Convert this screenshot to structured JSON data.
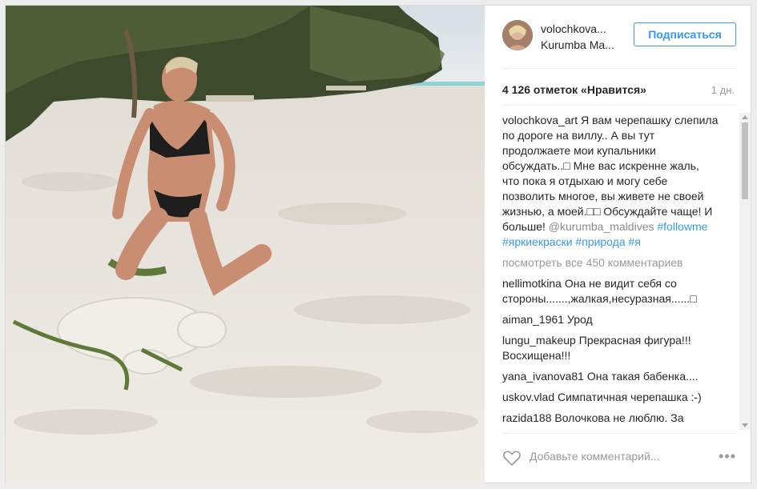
{
  "header": {
    "username": "volochkova...",
    "location": "Kurumba Ma...",
    "follow_label": "Подписаться"
  },
  "post": {
    "likes": "4 126 отметок «Нравится»",
    "age": "1 дн."
  },
  "caption": {
    "username": "volochkova_art",
    "text": "Я вам черепашку слепила по дороге на виллу.. А вы тут продолжаете мои купальники обсуждать..□ Мне вас искренне жаль, что пока я отдыхаю и могу себе позволить многое, вы живете не своей жизнью, а моей.□□ Обсуждайте чаще! И больше!",
    "mention": "@kurumba_maldives",
    "hashtags": "#followme #яркиекраски #природа #я"
  },
  "view_all_label": "посмотреть все 450 комментариев",
  "comments": [
    {
      "user": "nellimotkina",
      "text": "Она не видит себя со стороны.......,жалкая,несуразная......□"
    },
    {
      "user": "aiman_1961",
      "text": "Урод"
    },
    {
      "user": "lungu_makeup",
      "text": "Прекрасная фигура!!! Восхищена!!!"
    },
    {
      "user": "yana_ivanova81",
      "text": "Она такая бабенка...."
    },
    {
      "user": "uskov.vlad",
      "text": "Симпатичная черепашка :-)"
    },
    {
      "user": "razida188",
      "text": "Волочкова не люблю. За излишнее хвастовство, любовь к"
    }
  ],
  "footer": {
    "add_comment_placeholder": "Добавьте комментарий...",
    "more_icon": "•••"
  },
  "icons": {
    "heart": "heart-icon",
    "more": "ellipsis-icon"
  },
  "colors": {
    "accent": "#3897f0",
    "muted": "#999999",
    "sand": "#e9e6df",
    "sky": "#dfe6ec",
    "sea": "#8fd3d8"
  }
}
